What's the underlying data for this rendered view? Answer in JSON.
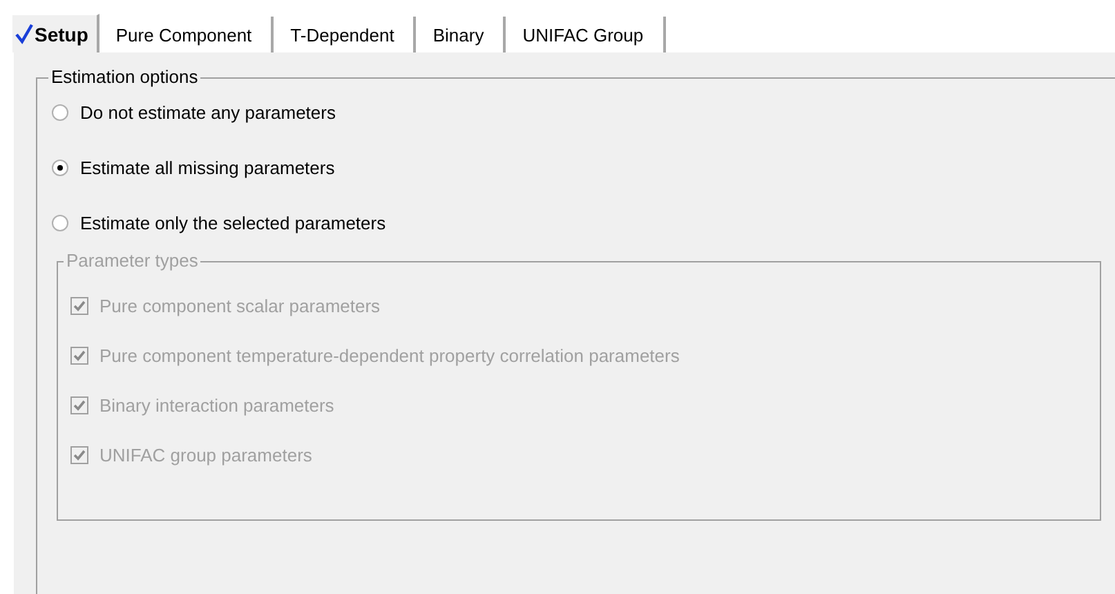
{
  "tabs": [
    {
      "label": "Setup",
      "selected": true,
      "complete": true
    },
    {
      "label": "Pure Component",
      "selected": false,
      "complete": false
    },
    {
      "label": "T-Dependent",
      "selected": false,
      "complete": false
    },
    {
      "label": "Binary",
      "selected": false,
      "complete": false
    },
    {
      "label": "UNIFAC Group",
      "selected": false,
      "complete": false
    }
  ],
  "estimation_options": {
    "title": "Estimation options",
    "options": [
      {
        "label": "Do not estimate any parameters",
        "selected": false
      },
      {
        "label": "Estimate all missing parameters",
        "selected": true
      },
      {
        "label": "Estimate only the selected parameters",
        "selected": false
      }
    ],
    "parameter_types": {
      "title": "Parameter types",
      "disabled": true,
      "items": [
        {
          "label": "Pure component scalar parameters",
          "checked": true
        },
        {
          "label": "Pure component temperature-dependent property correlation parameters",
          "checked": true
        },
        {
          "label": "Binary interaction parameters",
          "checked": true
        },
        {
          "label": "UNIFAC group parameters",
          "checked": true
        }
      ]
    }
  }
}
